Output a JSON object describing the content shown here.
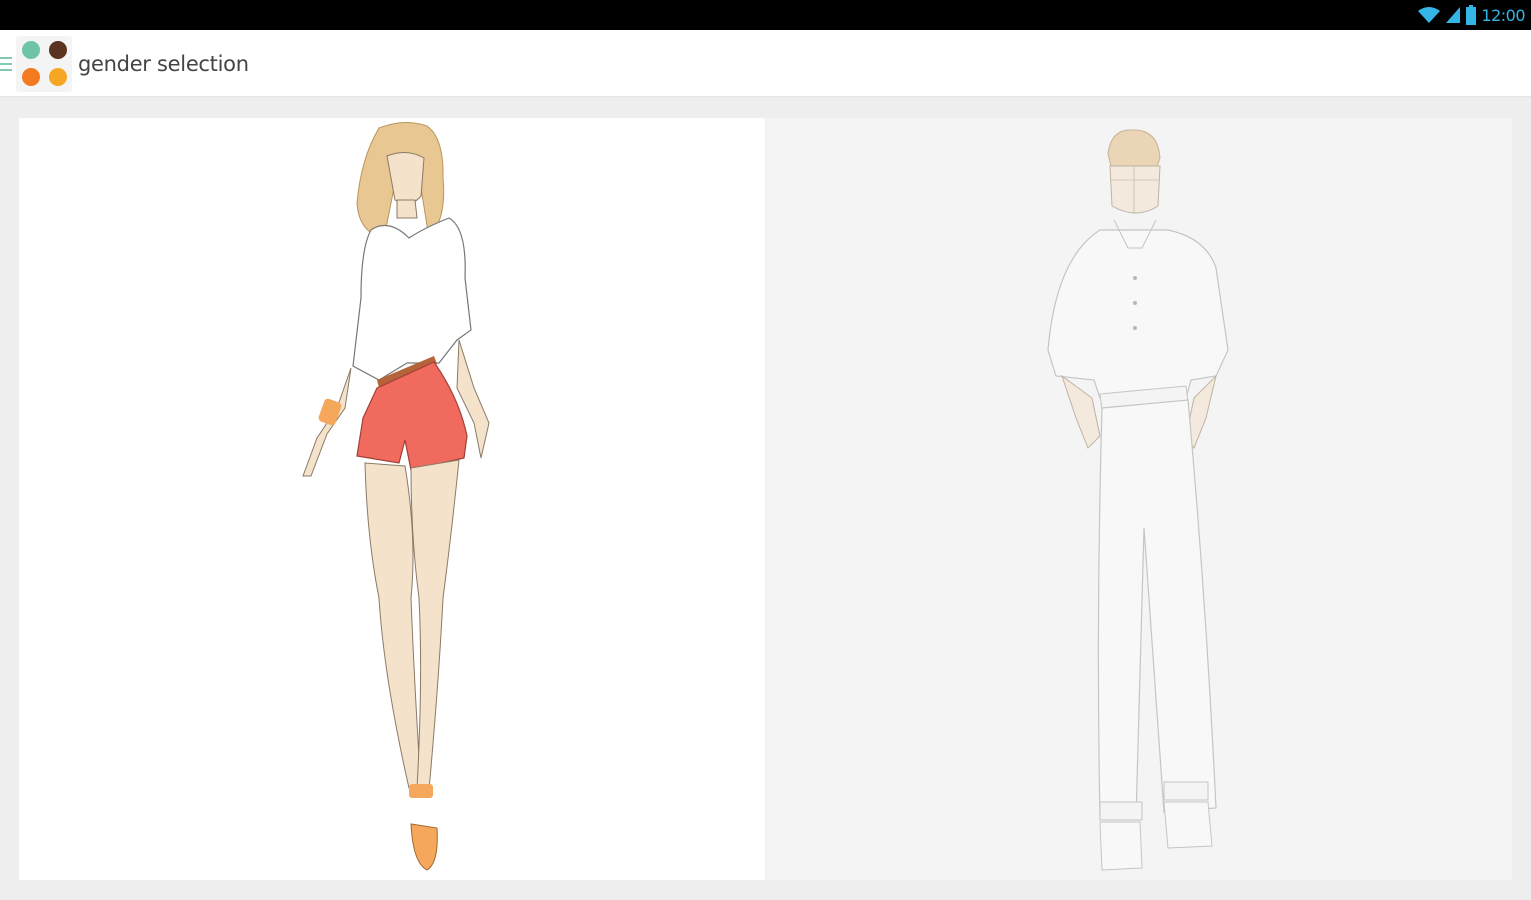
{
  "status_bar": {
    "time": "12:00",
    "icons": [
      "wifi-icon",
      "signal-icon",
      "battery-icon"
    ],
    "accent_color": "#33b5e5"
  },
  "action_bar": {
    "title": "gender selection",
    "drawer_icon": "drawer-menu-icon",
    "app_icon": "app-logo-dots",
    "logo_colors": [
      "#6fc3a8",
      "#5a3420",
      "#f47a20",
      "#f5a623"
    ]
  },
  "panels": {
    "female": {
      "name": "female"
    },
    "male": {
      "name": "male"
    }
  }
}
